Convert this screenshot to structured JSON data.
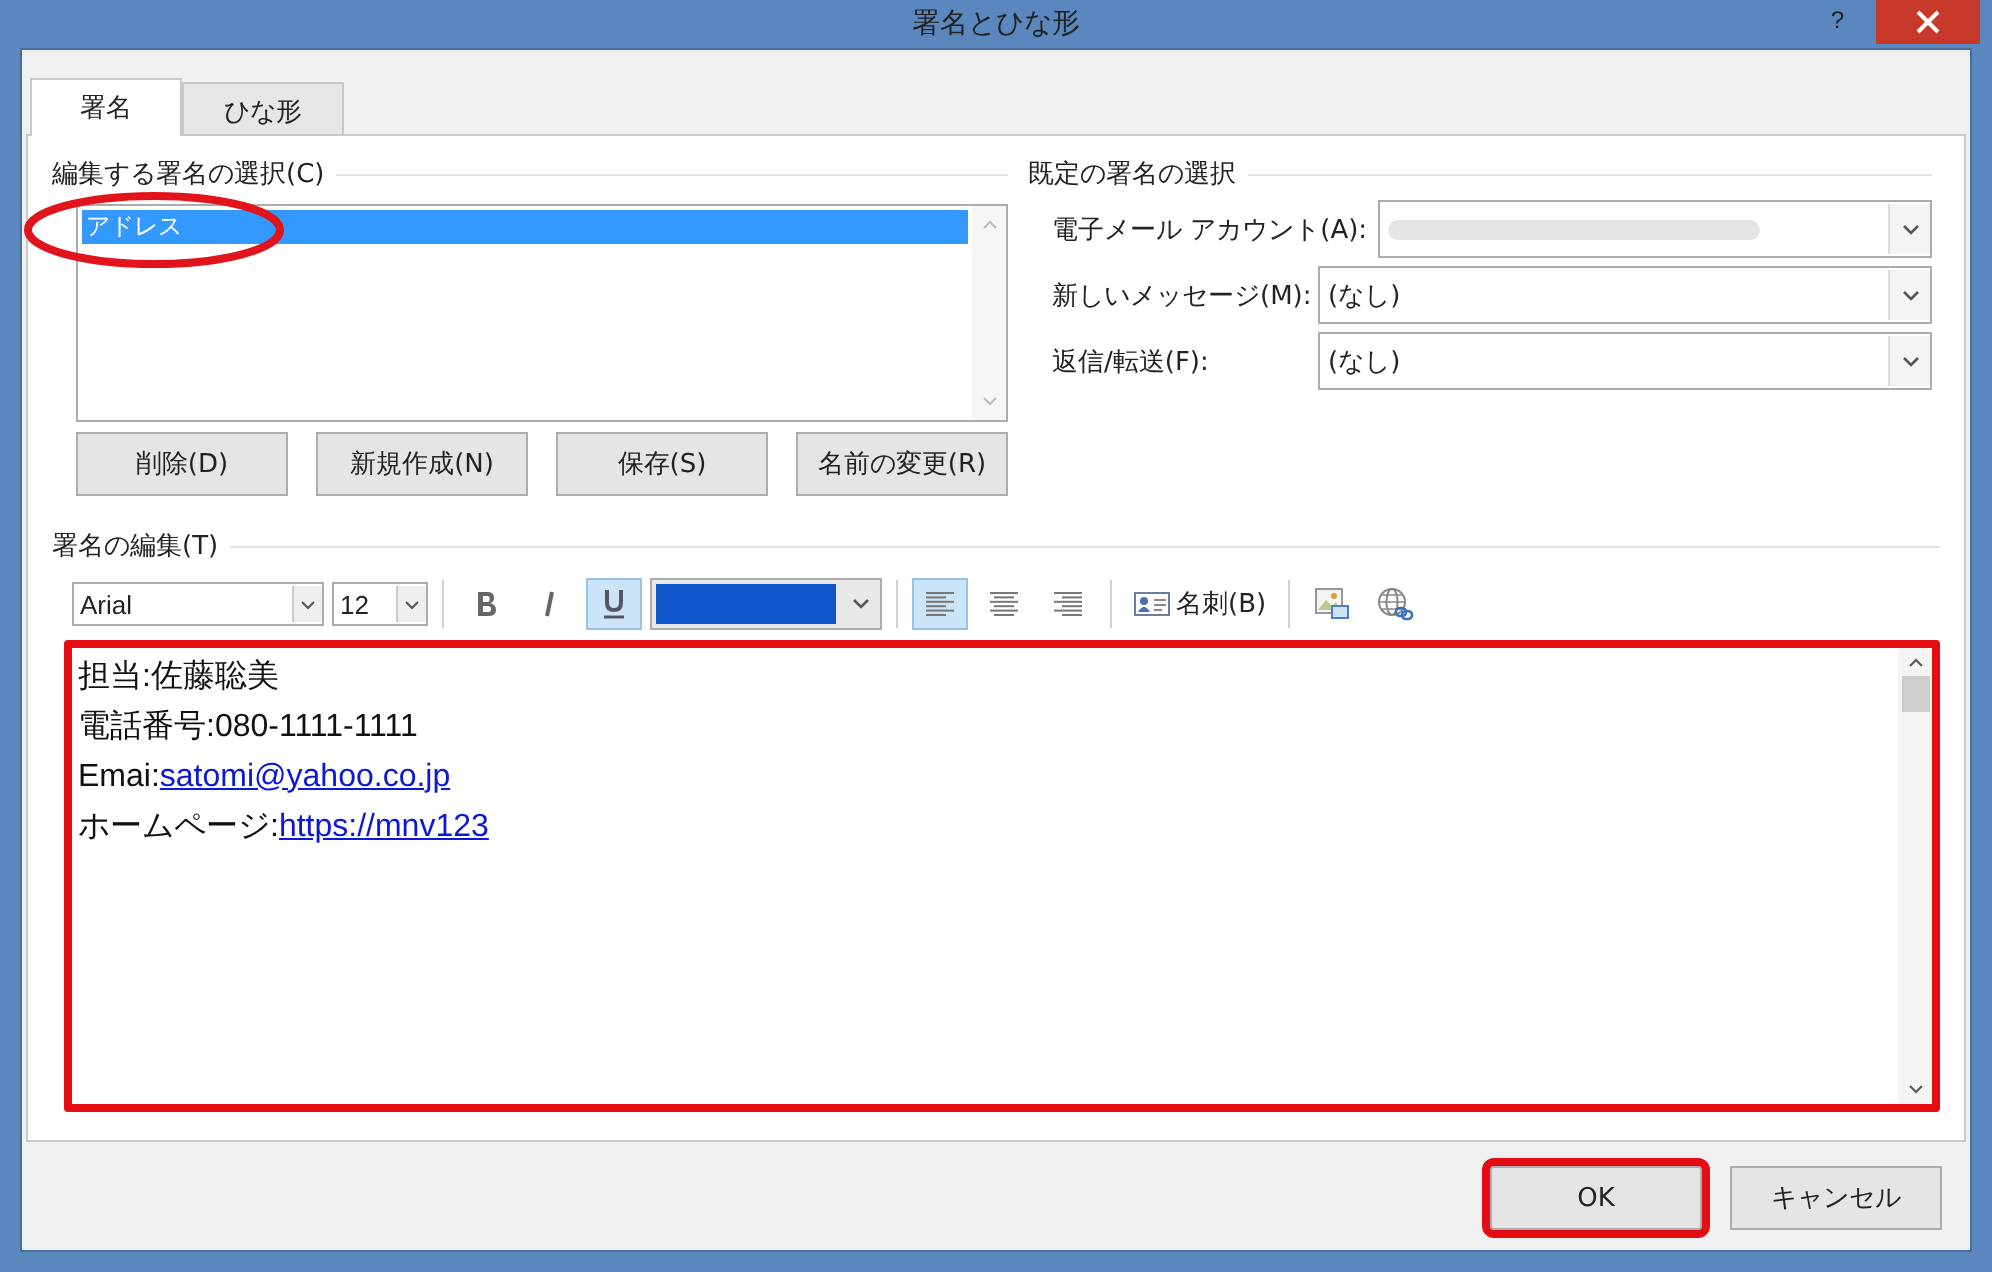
{
  "window": {
    "title": "署名とひな形",
    "help": "?"
  },
  "tabs": [
    {
      "label": "署名",
      "selected": true
    },
    {
      "label": "ひな形",
      "selected": false
    }
  ],
  "signature_select": {
    "label": "編集する署名の選択(C)",
    "items": [
      {
        "label": "アドレス",
        "selected": true,
        "circled": true
      }
    ],
    "buttons": [
      "削除(D)",
      "新規作成(N)",
      "保存(S)",
      "名前の変更(R)"
    ]
  },
  "default_signature": {
    "label": "既定の署名の選択",
    "fields": [
      {
        "label": "電子メール アカウント(A):",
        "redacted": true
      },
      {
        "label": "新しいメッセージ(M):",
        "value": "(なし)",
        "redacted": false
      },
      {
        "label": "返信/転送(F):",
        "value": "(なし)",
        "redacted": false
      }
    ]
  },
  "editor": {
    "label": "署名の編集(T)",
    "highlighted": true,
    "toolbar": {
      "font": "Arial",
      "size": "12",
      "bold": false,
      "italic": false,
      "underline": true,
      "color": "#1155cc",
      "alignments": [
        {
          "kind": "left",
          "selected": true
        },
        {
          "kind": "center",
          "selected": false
        },
        {
          "kind": "right",
          "selected": false
        }
      ],
      "card_button": "名刺(B)"
    },
    "lines": [
      {
        "label": "担当:",
        "value": "佐藤聡美",
        "link": false
      },
      {
        "label": "電話番号:",
        "value": "080-1111-1111",
        "link": false
      },
      {
        "label": "Emai:",
        "value": "satomi@yahoo.co.jp",
        "link": true
      },
      {
        "label": "ホームページ:",
        "value": "https://mnv123",
        "link": true
      }
    ]
  },
  "buttons": [
    {
      "label": "OK",
      "highlighted": true
    },
    {
      "label": "キャンセル",
      "highlighted": false
    }
  ]
}
